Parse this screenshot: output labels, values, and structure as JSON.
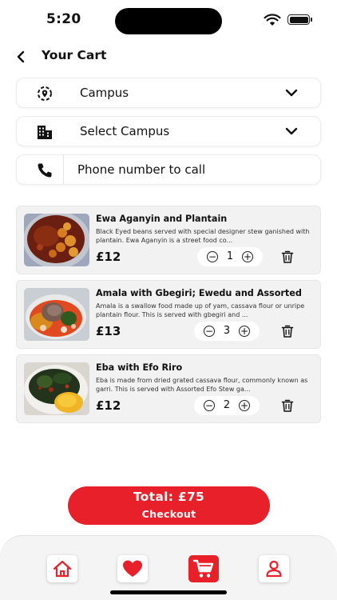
{
  "status_bar": {
    "time": "5:20"
  },
  "header": {
    "title": "Your Cart"
  },
  "campus_select": {
    "value": "Campus"
  },
  "campus_detail_select": {
    "value": "Select Campus"
  },
  "phone": {
    "placeholder": "Phone number to call"
  },
  "cart": {
    "items": [
      {
        "name": "Ewa Aganyin and Plantain",
        "description": "Black Eyed beans served with special designer stew ganished with plantain. Ewa Aganyin is a street food co...",
        "price": "£12",
        "quantity": "1"
      },
      {
        "name": "Amala with Gbegiri; Ewedu and Assorted",
        "description": "Amala is a swallow food made up of yam, cassava flour or unripe plantain flour. This is served with gbegiri and ...",
        "price": "£13",
        "quantity": "3"
      },
      {
        "name": "Eba with Efo Riro",
        "description": "Eba is made from dried grated cassava flour, commonly known as garri. This is served with Assorted Efo Stew ga...",
        "price": "£12",
        "quantity": "2"
      }
    ]
  },
  "checkout": {
    "total": "Total: £75",
    "label": "Checkout"
  },
  "nav": {
    "items": [
      {
        "icon": "home-icon",
        "active": false
      },
      {
        "icon": "heart-icon",
        "active": false
      },
      {
        "icon": "cart-icon",
        "active": true
      },
      {
        "icon": "profile-icon",
        "active": false
      }
    ]
  },
  "colors": {
    "accent": "#e8202a",
    "card_bg": "#f2f2f2",
    "nav_bg": "#f4f4f4"
  }
}
